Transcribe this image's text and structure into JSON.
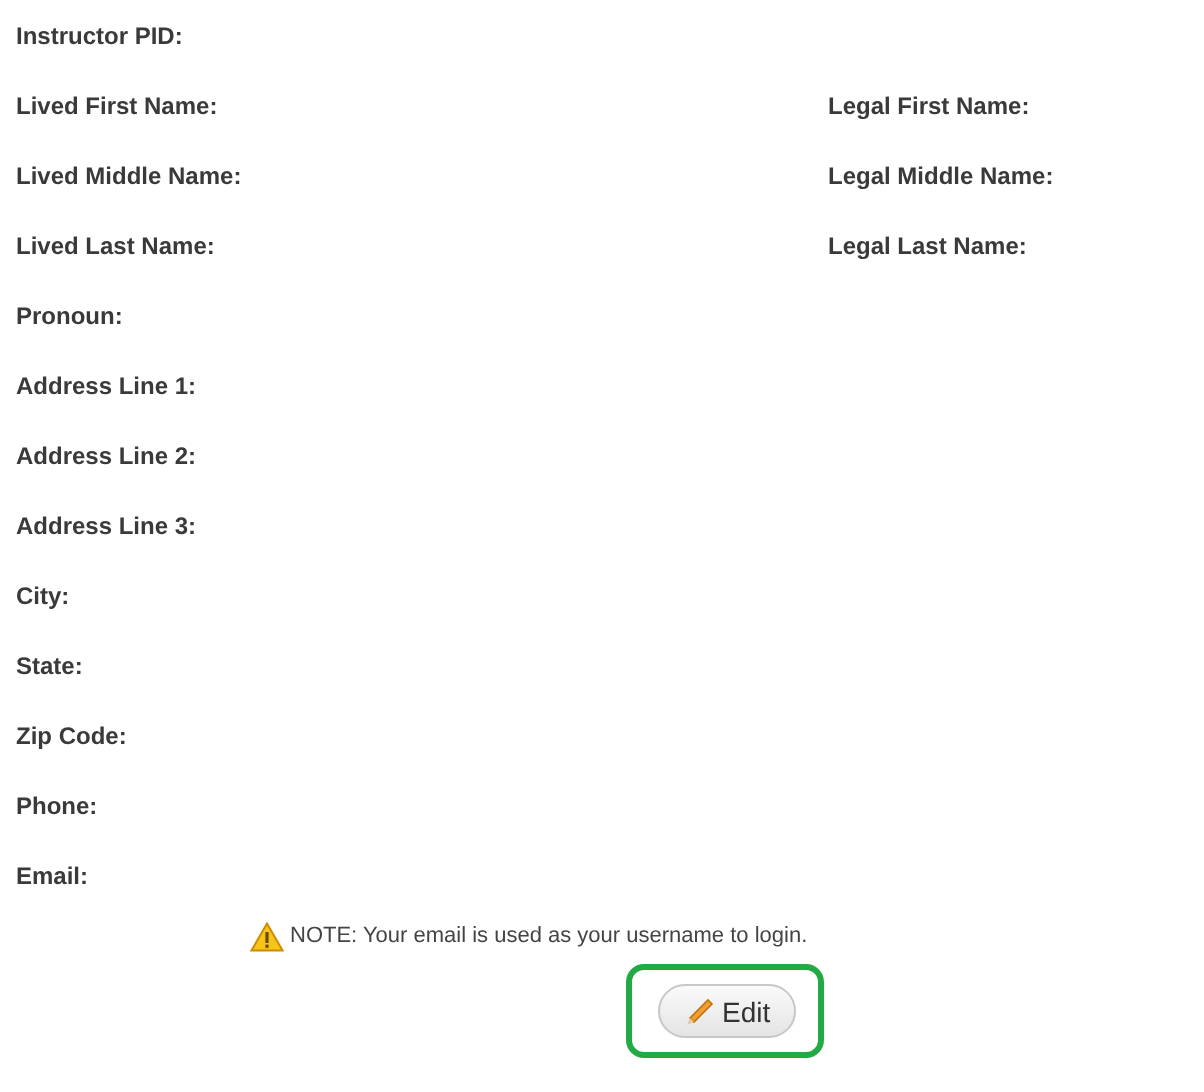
{
  "rows": [
    {
      "left": "Instructor PID:"
    },
    {
      "left": "Lived First Name:",
      "right": "Legal First Name:"
    },
    {
      "left": "Lived Middle Name:",
      "right": "Legal Middle Name:"
    },
    {
      "left": "Lived Last Name:",
      "right": "Legal Last Name:"
    },
    {
      "left": "Pronoun:"
    },
    {
      "left": "Address Line 1:"
    },
    {
      "left": "Address Line 2:"
    },
    {
      "left": "Address Line 3:"
    },
    {
      "left": "City:"
    },
    {
      "left": "State:"
    },
    {
      "left": "Zip Code:"
    },
    {
      "left": "Phone:"
    },
    {
      "left": "Email:"
    }
  ],
  "note": "NOTE: Your email is used as your username to login.",
  "edit_button": {
    "label": "Edit",
    "highlighted": true
  }
}
